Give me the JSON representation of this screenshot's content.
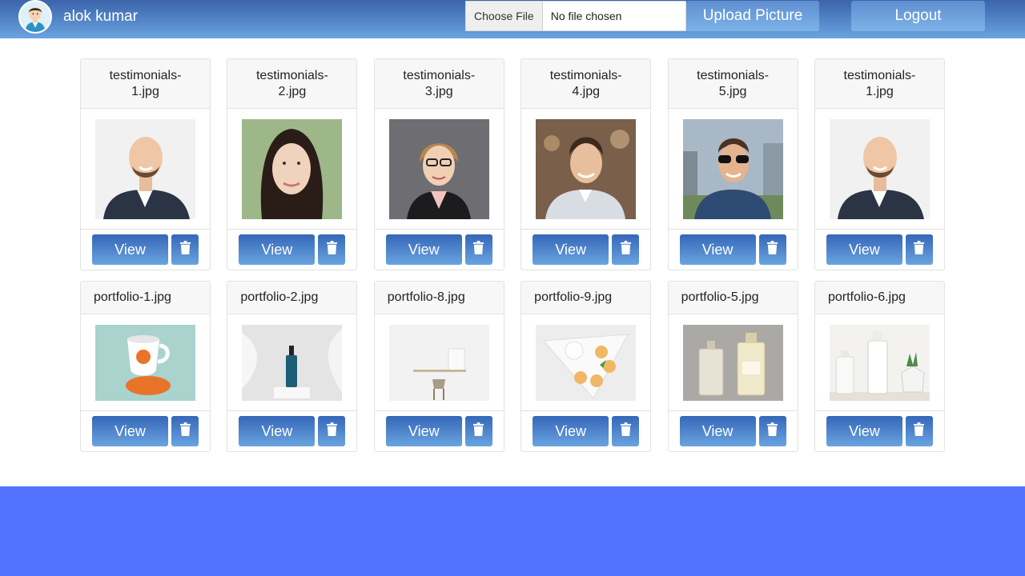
{
  "header": {
    "username": "alok kumar",
    "choose_file_label": "Choose File",
    "file_status": "No file chosen",
    "upload_label": "Upload Picture",
    "logout_label": "Logout"
  },
  "cards": [
    {
      "name": "testimonials-1.jpg",
      "view_label": "View"
    },
    {
      "name": "testimonials-2.jpg",
      "view_label": "View"
    },
    {
      "name": "testimonials-3.jpg",
      "view_label": "View"
    },
    {
      "name": "testimonials-4.jpg",
      "view_label": "View"
    },
    {
      "name": "testimonials-5.jpg",
      "view_label": "View"
    },
    {
      "name": "testimonials-1.jpg",
      "view_label": "View"
    },
    {
      "name": "portfolio-1.jpg",
      "view_label": "View"
    },
    {
      "name": "portfolio-2.jpg",
      "view_label": "View"
    },
    {
      "name": "portfolio-8.jpg",
      "view_label": "View"
    },
    {
      "name": "portfolio-9.jpg",
      "view_label": "View"
    },
    {
      "name": "portfolio-5.jpg",
      "view_label": "View"
    },
    {
      "name": "portfolio-6.jpg",
      "view_label": "View"
    }
  ],
  "colors": {
    "header_top": "#3b64ab",
    "header_bottom": "#6aa3df",
    "button": "#4a80cc",
    "footer_band": "#5271fe"
  },
  "icons": {
    "delete": "trash-icon",
    "avatar": "user-avatar-icon"
  }
}
